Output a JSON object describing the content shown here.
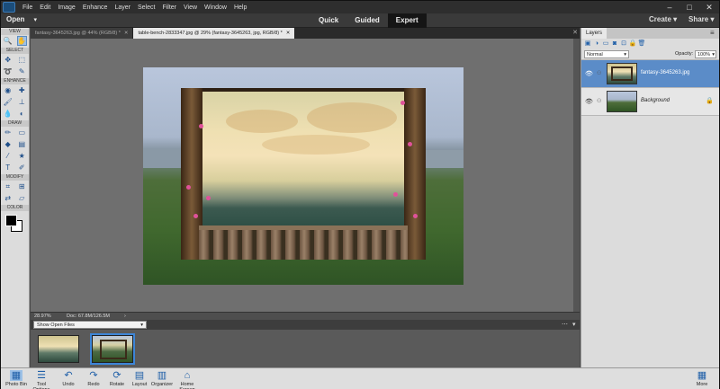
{
  "menu": [
    "File",
    "Edit",
    "Image",
    "Enhance",
    "Layer",
    "Select",
    "Filter",
    "View",
    "Window",
    "Help"
  ],
  "window_controls": [
    "–",
    "□",
    "✕"
  ],
  "modebar": {
    "open_label": "Open",
    "modes": [
      "Quick",
      "Guided",
      "Expert"
    ],
    "active_mode": "Expert",
    "create_label": "Create",
    "share_label": "Share"
  },
  "toolbox": {
    "sections": {
      "view": "VIEW",
      "select": "SELECT",
      "enhance": "ENHANCE",
      "draw": "DRAW",
      "modify": "MODIFY",
      "color": "COLOR"
    }
  },
  "doc_tabs": [
    {
      "label": "fantasy-3645263.jpg @ 44% (RGB/8) *",
      "close": "✕"
    },
    {
      "label": "table-bench-2833347.jpg @ 29% (fantasy-3645263, jpg, RGB/8) *",
      "close": "✕"
    }
  ],
  "doc_tabs_close_all": "✕",
  "status": {
    "zoom": "28.97%",
    "doc": "Doc: 67.8M/126.5M",
    "arrow": "›"
  },
  "photo_bin": {
    "show_label": "Show Open Files",
    "dropdown": "▾",
    "ctrl_more": "⋯",
    "ctrl_collapse": "▾"
  },
  "taskbar": {
    "items": [
      "Photo Bin",
      "Tool Options",
      "Undo",
      "Redo",
      "Rotate",
      "Layout",
      "Organizer",
      "Home Screen"
    ],
    "more_label": "More"
  },
  "layers_panel": {
    "tab_label": "Layers",
    "blend_mode": "Normal",
    "opacity_label": "Opacity:",
    "opacity_value": "100%",
    "layers": [
      {
        "name": "fantasy-3645263.jpg",
        "active": true
      },
      {
        "name": "Background",
        "active": false
      }
    ]
  },
  "colors": {
    "accent": "#5b8cc8",
    "tool_icon": "#1f5fa8",
    "active_mode_bg": "#151515"
  }
}
